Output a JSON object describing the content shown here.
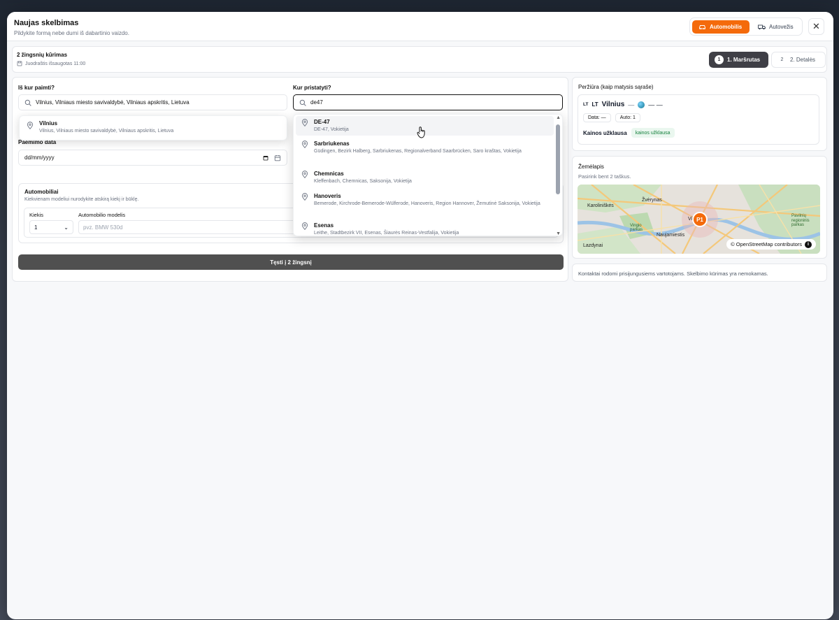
{
  "header": {
    "title": "Naujas skelbimas",
    "subtitle": "Pildykite formą nebe dumi iš dabartinio vaizdo.",
    "types": [
      {
        "label": "Automobilis",
        "icon": "car-icon"
      },
      {
        "label": "Autovežis",
        "icon": "truck-icon"
      }
    ]
  },
  "steps": {
    "title": "2 žingsnių kūrimas",
    "draft": "Juodraštis išsaugotas 11:00",
    "items": [
      {
        "num": "1",
        "label": "1. Maršrutas"
      },
      {
        "num": "2",
        "label": "2. Detalės"
      }
    ]
  },
  "form": {
    "pickup_label": "Iš kur paimti?",
    "pickup_value": "Vilnius, Vilniaus miesto savivaldybė, Vilniaus apskritis, Lietuva",
    "pickup_suggestion": {
      "name": "Vilnius",
      "desc": "Vilnius, Vilniaus miesto savivaldybė, Vilniaus apskritis, Lietuva"
    },
    "delivery_label": "Kur pristatyti?",
    "delivery_value": "de47",
    "date_label": "Paėmimo data",
    "date_placeholder": "dd/mm/yyyy",
    "cars_title": "Automobiliai",
    "cars_subtitle": "Kiekvienam modeliui nurodykite atskirą kiekį ir būklę.",
    "qty_label": "Kiekis",
    "qty_value": "1",
    "model_label": "Automobilio modelis",
    "model_placeholder": "pvz. BMW 530d",
    "continue_label": "Tęsti į 2 žingsnį"
  },
  "destination_suggestions": [
    {
      "name": "DE-47",
      "desc": "DE-47, Vokietija"
    },
    {
      "name": "Sarbriukenas",
      "desc": "Güdingen, Bezirk Halberg, Sarbriukenas, Regionalverband Saarbrücken, Saro kraštas, Vokietija"
    },
    {
      "name": "Chemnicas",
      "desc": "Kleffenbach, Chemnicas, Saksonija, Vokietija"
    },
    {
      "name": "Hanoveris",
      "desc": "Bemerode, Kirchrode-Bemerode-Wülferode, Hanoveris, Region Hannover, Žemutinė Saksonija, Vokietija"
    },
    {
      "name": "Esenas",
      "desc": "Leithe, Stadtbezirk VII, Esenas, Šiaurės Reinas-Vestfalija, Vokietija"
    }
  ],
  "preview": {
    "title": "Peržiūra (kaip matysis sąraše)",
    "flag_code": "LT",
    "country": "LT",
    "city": "Vilnius",
    "dash1": "—",
    "dest_dash": "— —",
    "date_chip": "Data: —",
    "auto_chip": "Auto: 1",
    "price_label": "Kainos užklausa",
    "price_badge": "kainos užklausa"
  },
  "map": {
    "title": "Žemėlapis",
    "hint": "Pasirink bent 2 taškus.",
    "labels": [
      "Karoliniškės",
      "Žvėrynas",
      "Vilnius",
      "Naujamiestis",
      "Lazdynai",
      "Vingio parkas",
      "Pavilnių regioninis parkas"
    ],
    "marker": "P1",
    "attribution": "© OpenStreetMap contributors"
  },
  "notice": "Kontaktai rodomi prisijungusiems vartotojams. Skelbimo kūrimas yra nemokamas.",
  "colors": {
    "accent": "#f46a0b",
    "dark": "#3f3f46"
  }
}
